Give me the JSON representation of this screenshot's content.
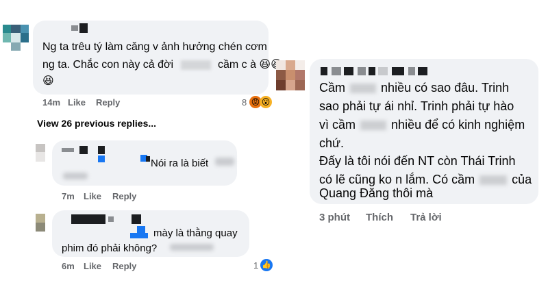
{
  "left_thread": {
    "comment1": {
      "text_line1": "Ng ta trêu tý làm căng v ảnh hưởng chén cơm",
      "text_line2_a": "ng ta. Chắc con này cả đời",
      "text_line2_b": "cầm c à",
      "time": "14m",
      "like": "Like",
      "reply": "Reply",
      "reaction_count": "8"
    },
    "view_previous": "View 26 previous replies...",
    "reply1": {
      "text": "Nói ra là biết",
      "time": "7m",
      "like": "Like",
      "reply": "Reply"
    },
    "reply2": {
      "text_line1": "mày là thằng quay",
      "text_line2": "phim đó phải không?",
      "time": "6m",
      "like": "Like",
      "reply": "Reply",
      "reaction_count": "1"
    }
  },
  "right_comment": {
    "lines": [
      "Cầm",
      "nhiều có sao đâu. Trinh",
      "sao phải tự ái nhỉ. Trinh phải tự hào",
      "vì cầm",
      "nhiều để có kinh nghiệm",
      "chứ.",
      "Đấy là tôi nói đến NT còn Thái Trinh",
      "có lẽ cũng ko n lắm. Có cầm",
      "của",
      "Quang Đăng thôi mà"
    ],
    "time": "3 phút",
    "like": "Thích",
    "reply": "Trả lời"
  },
  "icons": {
    "laugh": "grinning-squinting-face-icon",
    "angry": "angry-face-icon",
    "wow": "surprised-face-icon",
    "like": "thumbs-up-icon"
  },
  "colors": {
    "bubble": "#f0f2f5",
    "meta_text": "#65676b",
    "like_blue": "#1877f2"
  }
}
